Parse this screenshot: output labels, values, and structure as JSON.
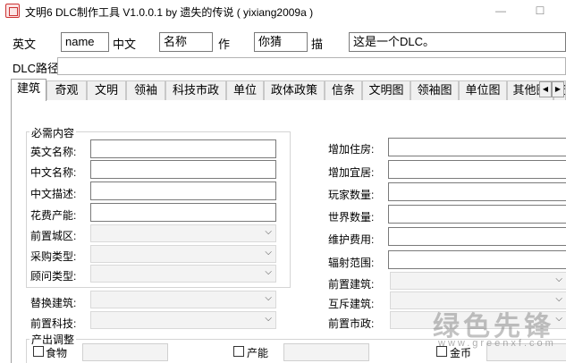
{
  "window": {
    "title": "文明6 DLC制作工具 V1.0.0.1 by 遗失的传说 ( yixiang2009a )",
    "min_glyph": "—",
    "max_glyph": "☐"
  },
  "meta": {
    "en_label": "英文",
    "en_value": "name",
    "cn_label": "中文",
    "cn_value": "名称",
    "author_label": "作",
    "author_value": "你猜",
    "desc_label": "描",
    "desc_value": "这是一个DLC。"
  },
  "path": {
    "label": "DLC路径",
    "value": ""
  },
  "tabs": [
    {
      "label": "建筑",
      "active": true
    },
    {
      "label": "奇观",
      "active": false
    },
    {
      "label": "文明",
      "active": false
    },
    {
      "label": "领袖",
      "active": false
    },
    {
      "label": "科技市政",
      "active": false
    },
    {
      "label": "单位",
      "active": false
    },
    {
      "label": "政体政策",
      "active": false
    },
    {
      "label": "信条",
      "active": false
    },
    {
      "label": "文明图",
      "active": false
    },
    {
      "label": "领袖图",
      "active": false
    },
    {
      "label": "单位图",
      "active": false
    },
    {
      "label": "其他图",
      "active": false
    },
    {
      "label": "资",
      "active": false
    }
  ],
  "tab_scroll": {
    "left": "◀",
    "right": "▶"
  },
  "required": {
    "title": "必需内容",
    "en_name_label": "英文名称:",
    "en_name_value": "",
    "cn_name_label": "中文名称:",
    "cn_name_value": "",
    "cn_desc_label": "中文描述:",
    "cn_desc_value": "",
    "cost_label": "花费产能:",
    "cost_value": "",
    "district_label": "前置城区:",
    "purchase_label": "采购类型:",
    "advisor_label": "顾问类型:"
  },
  "optional": {
    "replace_label": "替换建筑:",
    "prereq_tech_label": "前置科技:",
    "housing_label": "增加住房:",
    "housing_value": "",
    "amenity_label": "增加宜居:",
    "amenity_value": "",
    "player_count_label": "玩家数量:",
    "player_count_value": "",
    "world_count_label": "世界数量:",
    "world_count_value": "",
    "maintenance_label": "维护费用:",
    "maintenance_value": "",
    "radius_label": "辐射范围:",
    "radius_value": "",
    "prereq_building_label": "前置建筑:",
    "exclusive_building_label": "互斥建筑:",
    "prereq_civic_label": "前置市政:"
  },
  "yield": {
    "title": "产出调整",
    "food_label": "食物",
    "production_label": "产能",
    "gold_label": "金币"
  },
  "watermark": {
    "text": "绿色先锋",
    "url": "www.greenxf.com"
  },
  "icons": {
    "combo_arrow": "⌵",
    "app": "app-icon"
  }
}
